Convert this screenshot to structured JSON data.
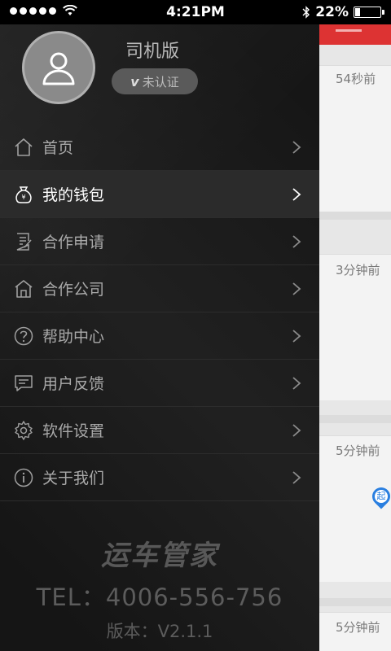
{
  "status_bar": {
    "time": "4:21PM",
    "battery_text": "22%",
    "battery_level": 0.22
  },
  "profile": {
    "app_edition": "司机版",
    "verify_icon": "v",
    "verify_status": "未认证"
  },
  "menu": {
    "items": [
      {
        "label": "首页",
        "icon": "home-icon",
        "active": false
      },
      {
        "label": "我的钱包",
        "icon": "wallet-icon",
        "active": true
      },
      {
        "label": "合作申请",
        "icon": "form-icon",
        "active": false
      },
      {
        "label": "合作公司",
        "icon": "company-icon",
        "active": false
      },
      {
        "label": "帮助中心",
        "icon": "help-icon",
        "active": false
      },
      {
        "label": "用户反馈",
        "icon": "feedback-icon",
        "active": false
      },
      {
        "label": "软件设置",
        "icon": "gear-icon",
        "active": false
      },
      {
        "label": "关于我们",
        "icon": "info-icon",
        "active": false
      }
    ]
  },
  "brand": {
    "logo_text": "运车管家",
    "tel": "TEL：4006-556-756",
    "version": "版本：V2.1.1"
  },
  "background_list": {
    "times": [
      "54秒前",
      "3分钟前",
      "5分钟前",
      "5分钟前"
    ],
    "pin_label": "起"
  },
  "colors": {
    "drawer_bg": "#1c1c1c",
    "active_row": "#2b2b2b",
    "accent_red": "#dd3333",
    "pin_blue": "#2a7fe0"
  }
}
